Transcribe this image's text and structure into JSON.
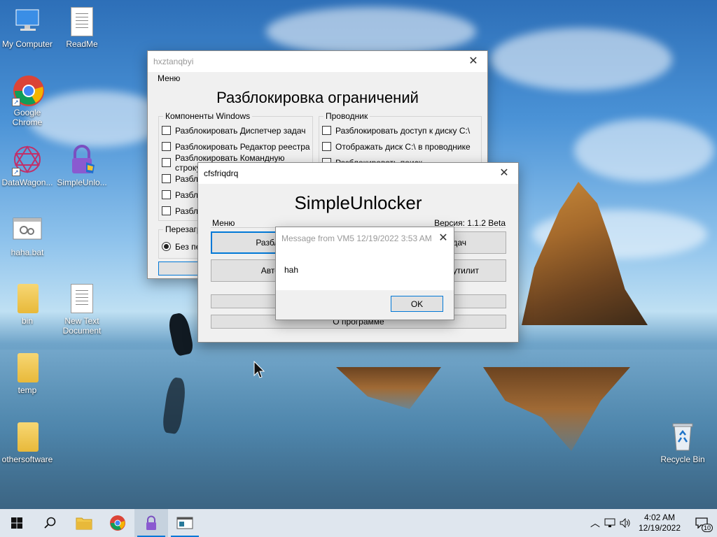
{
  "desktop": {
    "icons": [
      {
        "label": "My Computer"
      },
      {
        "label": "ReadMe"
      },
      {
        "label": "Google Chrome"
      },
      {
        "label": "DataWagon..."
      },
      {
        "label": "SimpleUnlo..."
      },
      {
        "label": "haha.bat"
      },
      {
        "label": "bin"
      },
      {
        "label": "New Text Document"
      },
      {
        "label": "temp"
      },
      {
        "label": "othersoftware"
      },
      {
        "label": "Recycle Bin"
      }
    ]
  },
  "win1": {
    "title": "hxztanqbyi",
    "menu": "Меню",
    "heading": "Разблокировка ограничений",
    "group_windows": {
      "label": "Компоненты Windows",
      "items": [
        "Разблокировать Диспетчер задач",
        "Разблокировать Редактор реестра",
        "Разблокировать Командную строку",
        "Разбло",
        "Разбло",
        "Разбло"
      ]
    },
    "group_explorer": {
      "label": "Проводник",
      "items": [
        "Разблокировать доступ к диску C:\\",
        "Отображать диск C:\\ в проводнике",
        "Разблокировать поиск"
      ]
    },
    "group_reboot": {
      "label": "Перезагру",
      "radio": "Без пе"
    }
  },
  "win2": {
    "title": "cfsfriqdrq",
    "heading": "SimpleUnlocker",
    "menu": "Меню",
    "version": "Версия: 1.1.2 Beta",
    "buttons": [
      "Разблокиров",
      "задач",
      "Автозапус",
      "утилит",
      "",
      "О программе"
    ]
  },
  "msg": {
    "title": "Message from VM5 12/19/2022 3:53 AM",
    "text": "hah",
    "ok": "OK"
  },
  "taskbar": {
    "time": "4:02 AM",
    "date": "12/19/2022",
    "notif_count": "10"
  }
}
